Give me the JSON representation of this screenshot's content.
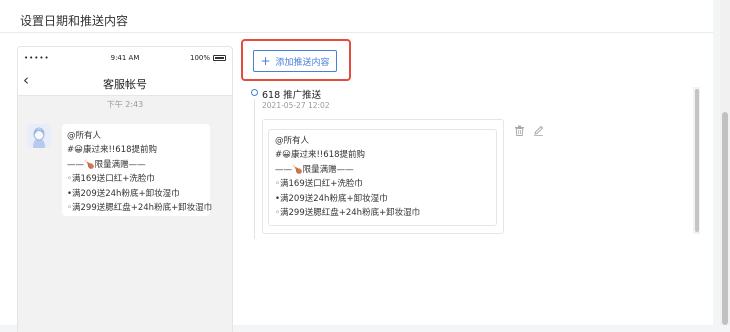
{
  "section": {
    "title": "设置日期和推送内容"
  },
  "phone": {
    "status": {
      "signal": "•••••",
      "time": "9:41 AM",
      "battery": "100%"
    },
    "nav": {
      "back_icon": "chevron-left-icon",
      "title": "客服帐号"
    },
    "chat_time": "下午 2:43",
    "message": {
      "lines": [
        "@所有人",
        "#😀康过来!!618提前购",
        "——🍗限量满赠——",
        "◦满169送口红+洗脸巾",
        "•满209送24h粉底+卸妆湿巾",
        "◦满299送腮红盘+24h粉底+卸妆湿巾"
      ]
    }
  },
  "add_button": {
    "icon": "plus-icon",
    "label": "添加推送内容"
  },
  "push": {
    "title": "618 推广推送",
    "date": "2021-05-27 12:02",
    "lines": [
      "@所有人",
      "#😀康过来!!618提前购",
      "——🍗限量满赠——",
      "◦满169送口红+洗脸巾",
      "•满209送24h粉底+卸妆湿巾",
      "◦满299送腮红盘+24h粉底+卸妆湿巾"
    ],
    "actions": {
      "delete_icon": "trash-icon",
      "edit_icon": "pencil-icon"
    }
  },
  "colors": {
    "accent": "#4a7fd6",
    "highlight": "#e44b3c",
    "background": "#f4f5f7"
  }
}
